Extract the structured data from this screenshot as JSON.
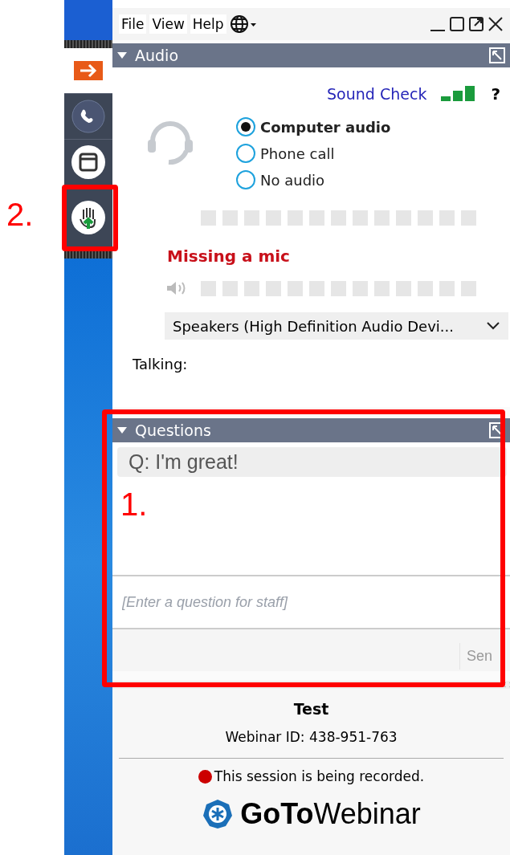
{
  "menu": [
    "File",
    "View",
    "Help"
  ],
  "sidebar": [
    {
      "kind": "arrow",
      "selected": true
    },
    {
      "kind": "phone",
      "selected": false
    },
    {
      "kind": "window",
      "selected": false
    },
    {
      "kind": "hand",
      "selected": false
    }
  ],
  "audio": {
    "title": "Audio",
    "expanded": true,
    "sound_check": "Sound Check",
    "help": "?",
    "options": [
      {
        "label": "Computer audio",
        "selected": true
      },
      {
        "label": "Phone call",
        "selected": false
      },
      {
        "label": "No audio",
        "selected": false
      }
    ],
    "mic_warning": "Missing a mic",
    "speaker_device": "Speakers (High Definition Audio Devi...",
    "talking": "Talking:"
  },
  "questions": {
    "title": "Questions",
    "expanded": true,
    "items": [
      "Q: I'm great!"
    ],
    "placeholder": "[Enter a question for staff]",
    "send": "Sen"
  },
  "footer": {
    "title": "Test",
    "webinar_id": "Webinar ID: 438-951-763",
    "recording": "This session is being recorded.",
    "logo_bold": "GoTo",
    "logo_light": "Webinar"
  },
  "annotations": [
    {
      "label": "1."
    },
    {
      "label": "2."
    }
  ]
}
